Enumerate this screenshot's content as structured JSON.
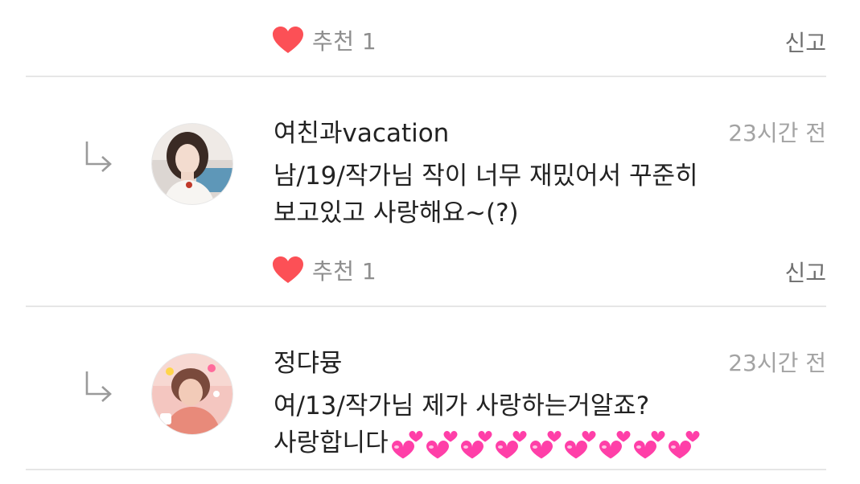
{
  "comments": [
    {
      "like_label": "추천 1",
      "report_label": "신고"
    },
    {
      "username": "여친과vacation",
      "time": "23시간 전",
      "body_lines": [
        "남/19/작가님 작이 너무 재밌어서 꾸준히",
        "보고있고 사랑해요~(?)"
      ],
      "like_label": "추천 1",
      "report_label": "신고"
    },
    {
      "username": "정댜뮹",
      "time": "23시간 전",
      "body_lines": [
        "여/13/작가님 제가 사랑하는거알죠?",
        "사랑합니다"
      ],
      "emoji_hearts": 9
    }
  ],
  "colors": {
    "heart": "#fc5056",
    "emoji_heart": "#ff3fa8",
    "divider": "#e6e6e6"
  },
  "icons": {
    "like": "heart-icon",
    "reply": "reply-arrow-icon",
    "emoji": "two-hearts-emoji"
  }
}
